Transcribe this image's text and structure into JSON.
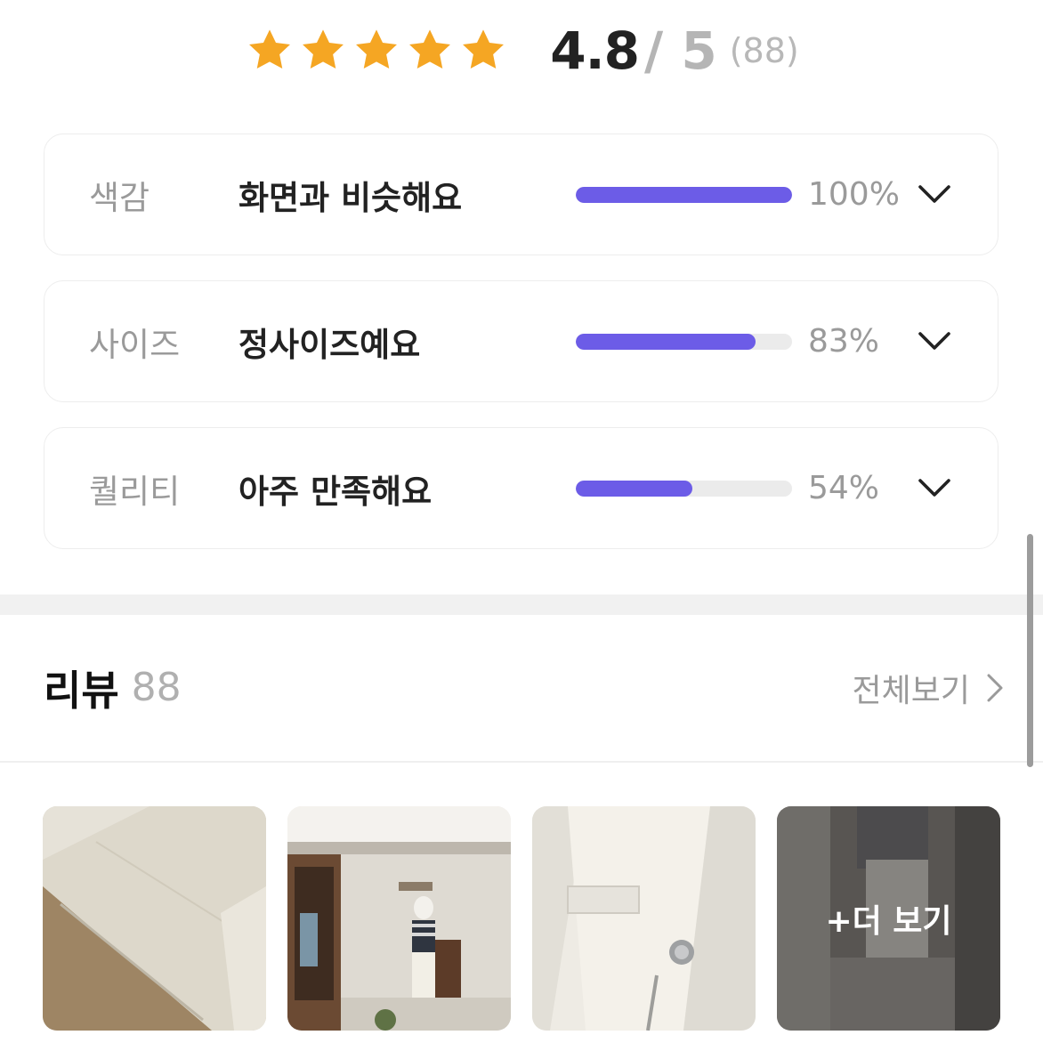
{
  "rating": {
    "stars": 5,
    "star_color": "#f5a623",
    "score": "4.8",
    "max": "/ 5",
    "count": "(88)"
  },
  "attributes": [
    {
      "label": "색감",
      "value": "화면과 비슷해요",
      "percent": 100,
      "percent_text": "100%"
    },
    {
      "label": "사이즈",
      "value": "정사이즈예요",
      "percent": 83,
      "percent_text": "83%"
    },
    {
      "label": "퀄리티",
      "value": "아주 만족해요",
      "percent": 54,
      "percent_text": "54%"
    }
  ],
  "bar_color": "#6c5ce7",
  "reviews": {
    "title": "리뷰",
    "count": "88",
    "view_all": "전체보기",
    "more_label": "+더 보기",
    "thumbnails": [
      "fabric-closeup",
      "street-photo",
      "waistband-closeup",
      "mirror-selfie"
    ]
  }
}
